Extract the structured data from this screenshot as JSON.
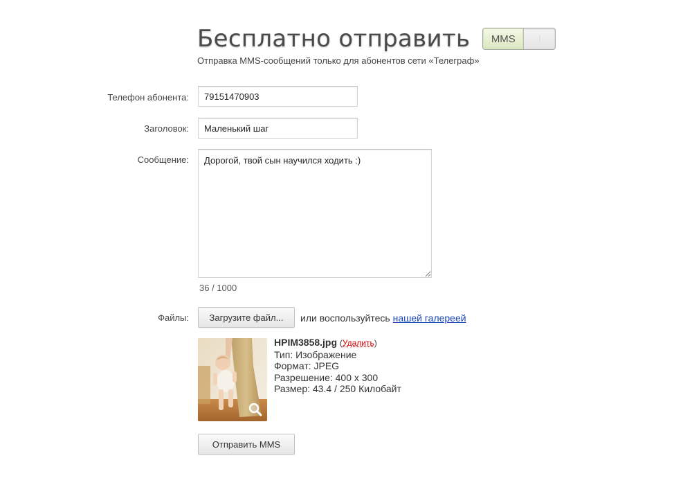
{
  "header": {
    "title": "Бесплатно отправить",
    "toggle_label": "MMS",
    "subtitle": "Отправка MMS-сообщений только для абонентов сети «Телеграф»"
  },
  "form": {
    "phone_label": "Телефон абонента:",
    "phone_value": "79151470903",
    "subject_label": "Заголовок:",
    "subject_value": "Маленький шаг",
    "message_label": "Сообщение:",
    "message_value": "Дорогой, твой сын научился ходить :)",
    "counter": "36 / 1000",
    "files_label": "Файлы:",
    "upload_button": "Загрузите файл...",
    "or_text": "или воспользуйтесь",
    "gallery_link": "нашей галереей",
    "submit_button": "Отправить MMS"
  },
  "attachment": {
    "file_name": "HPIM3858.jpg",
    "paren_open": "(",
    "delete_label": "Удалить",
    "paren_close": ")",
    "type_line": "Тип: Изображение",
    "format_line": "Формат: JPEG",
    "resolution_line": "Разрешение: 400 x 300",
    "size_line": "Размер: 43.4 / 250 Килобайт"
  },
  "colors": {
    "link": "#1a44b8",
    "delete": "#d40000",
    "toggle_on_bg": "#dbe8c2"
  },
  "icons": {
    "zoom": "magnifier-icon",
    "resize": "resize-grip-icon"
  }
}
